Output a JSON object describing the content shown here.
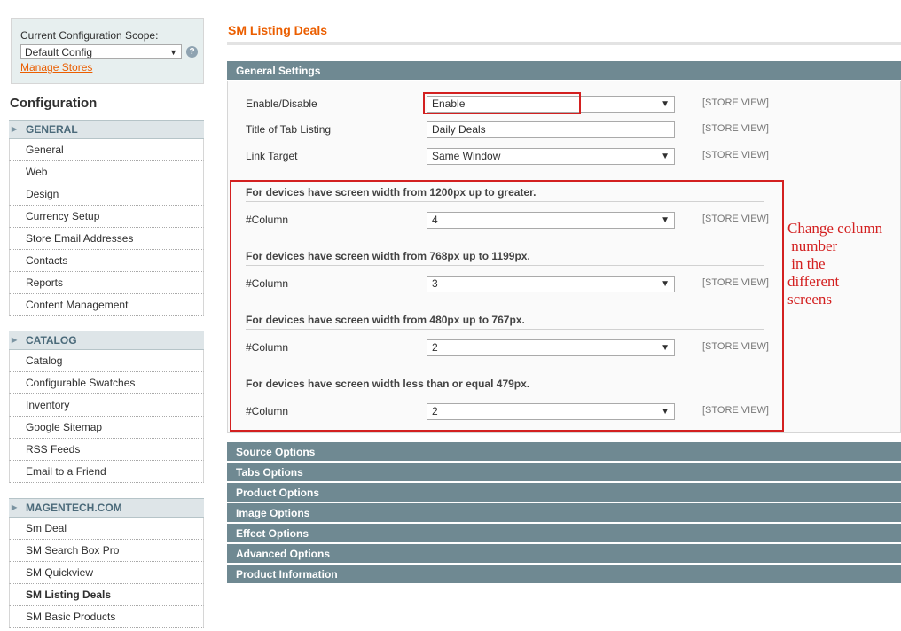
{
  "scope": {
    "label": "Current Configuration Scope:",
    "selected": "Default Config",
    "help_glyph": "?",
    "manage_link": "Manage Stores"
  },
  "sidebar": {
    "title": "Configuration",
    "groups": [
      {
        "header": "GENERAL",
        "items": [
          "General",
          "Web",
          "Design",
          "Currency Setup",
          "Store Email Addresses",
          "Contacts",
          "Reports",
          "Content Management"
        ]
      },
      {
        "header": "CATALOG",
        "items": [
          "Catalog",
          "Configurable Swatches",
          "Inventory",
          "Google Sitemap",
          "RSS Feeds",
          "Email to a Friend"
        ]
      },
      {
        "header": "MAGENTECH.COM",
        "items": [
          "Sm Deal",
          "SM Search Box Pro",
          "SM Quickview",
          "SM Listing Deals",
          "SM Basic Products"
        ]
      }
    ],
    "active_item": "SM Listing Deals"
  },
  "main": {
    "heading": "SM Listing Deals",
    "general_section": "General Settings",
    "fields": {
      "enable": {
        "label": "Enable/Disable",
        "value": "Enable",
        "scope": "[STORE VIEW]"
      },
      "title": {
        "label": "Title of Tab Listing",
        "value": "Daily Deals",
        "scope": "[STORE VIEW]"
      },
      "target": {
        "label": "Link Target",
        "value": "Same Window",
        "scope": "[STORE VIEW]"
      }
    },
    "responsive": [
      {
        "heading": "For devices have screen width from 1200px up to greater.",
        "label": "#Column",
        "value": "4",
        "scope": "[STORE VIEW]"
      },
      {
        "heading": "For devices have screen width from 768px up to 1199px.",
        "label": "#Column",
        "value": "3",
        "scope": "[STORE VIEW]"
      },
      {
        "heading": "For devices have screen width from 480px up to 767px.",
        "label": "#Column",
        "value": "2",
        "scope": "[STORE VIEW]"
      },
      {
        "heading": "For devices have screen width less than or equal 479px.",
        "label": "#Column",
        "value": "2",
        "scope": "[STORE VIEW]"
      }
    ],
    "collapsed_sections": [
      "Source Options",
      "Tabs Options",
      "Product Options",
      "Image Options",
      "Effect Options",
      "Advanced Options",
      "Product Information"
    ]
  },
  "annotation": {
    "text": "Change column\n number\n in the\ndifferent\nscreens",
    "color": "#d32020"
  },
  "colors": {
    "accent": "#eb5e00",
    "section_bar": "#6f8992",
    "nav_header": "#dee5e8"
  }
}
